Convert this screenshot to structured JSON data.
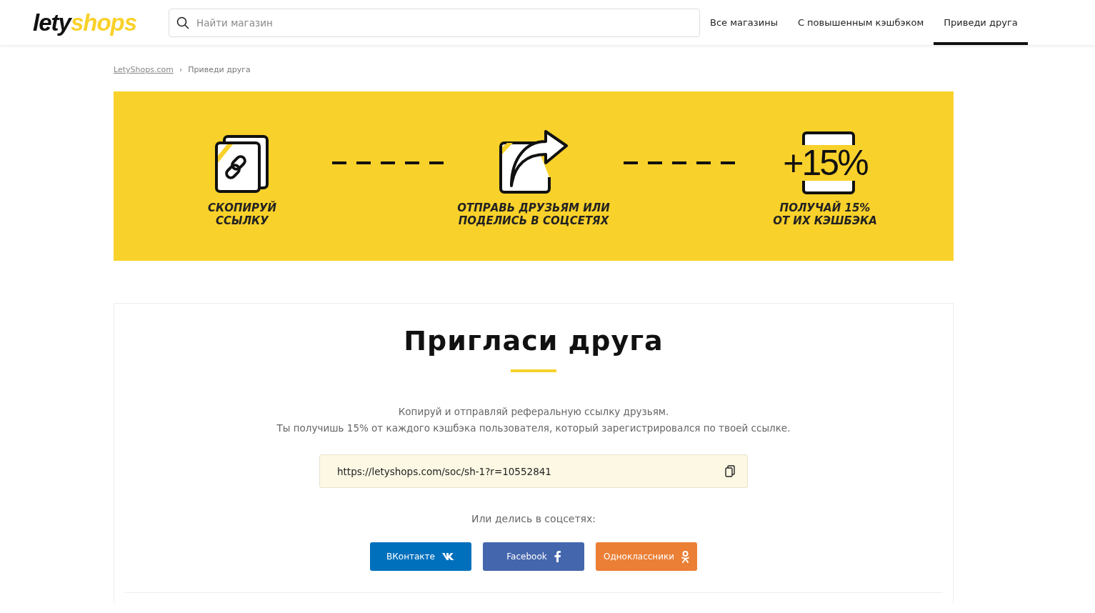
{
  "header": {
    "logo": {
      "dark": "lety",
      "light": "shops"
    },
    "search": {
      "placeholder": "Найти магазин"
    },
    "nav": [
      {
        "label": "Все магазины",
        "selected": false
      },
      {
        "label": "С повышенным кэшбэком",
        "selected": false
      },
      {
        "label": "Приведи друга",
        "selected": true
      }
    ]
  },
  "breadcrumbs": [
    {
      "label": "LetyShops.com",
      "kind": "link"
    },
    {
      "label": "›",
      "kind": "separator"
    },
    {
      "label": "Приведи друга",
      "kind": "current"
    }
  ],
  "steps": [
    {
      "kind": "copy",
      "lines": [
        "СКОПИРУЙ",
        "ССЫЛКУ"
      ]
    },
    {
      "kind": "share",
      "lines": [
        "ОТПРАВЬ ДРУЗЬЯМ ИЛИ",
        "ПОДЕЛИСЬ В СОЦСЕТЯХ"
      ]
    },
    {
      "kind": "percent",
      "icon_text": "+15%",
      "lines": [
        "ПОЛУЧАЙ 15%",
        "ОТ ИХ КЭШБЭКА"
      ]
    }
  ],
  "invite": {
    "title": "Пригласи друга",
    "description": [
      "Копируй и отправляй реферальную ссылку друзьям.",
      "Ты получишь 15% от каждого кэшбэка пользователя, который зарегистрировался по твоей ссылке."
    ],
    "link": "https://letyshops.com/soc/sh-1?r=10552841",
    "share_label": "Или делись в соцсетях:",
    "social": [
      {
        "label": "ВКонтакте",
        "kind": "vk",
        "color": "#0070bc"
      },
      {
        "label": "Facebook",
        "kind": "fb",
        "color": "#4466ad"
      },
      {
        "label": "Одноклассники",
        "kind": "ok",
        "color": "#eb7f35"
      }
    ]
  }
}
